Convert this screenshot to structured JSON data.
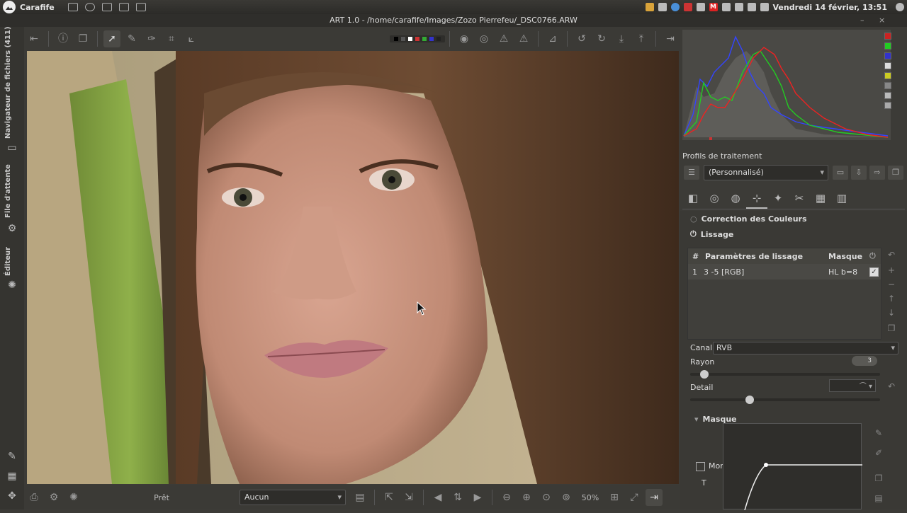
{
  "topbar": {
    "app_name": "Carafife",
    "datetime": "Vendredi 14 février, 13:51",
    "tray_badge": "M"
  },
  "window": {
    "title": "ART 1.0 - /home/carafife/Images/Zozo Pierrefeu/_DSC0766.ARW",
    "minimize": "–",
    "close": "×"
  },
  "left_strip": {
    "file_browser_tab": "Navigateur de fichiers (411)",
    "queue_tab": "File d'attente",
    "editor_tab": "Éditeur"
  },
  "bottom": {
    "status": "Prêt",
    "preset_value": "Aucun",
    "zoom": "50%"
  },
  "profiles": {
    "section_title": "Profils de traitement",
    "selected": "(Personnalisé)"
  },
  "panel": {
    "color_correction": "Correction des Couleurs",
    "smoothing": "Lissage",
    "table": {
      "col_num": "#",
      "col_params": "Paramètres de lissage",
      "col_mask": "Masque",
      "rows": [
        {
          "num": "1",
          "params": "3 -5 [RGB]",
          "mask": "HL b=8"
        }
      ]
    },
    "channel_label": "Canal:",
    "channel_value": "RVB",
    "radius_label": "Rayon",
    "radius_value": "3",
    "detail_label": "Detail",
    "mask_section": "Masque",
    "show_label": "Montrer",
    "curve_label": "T"
  }
}
